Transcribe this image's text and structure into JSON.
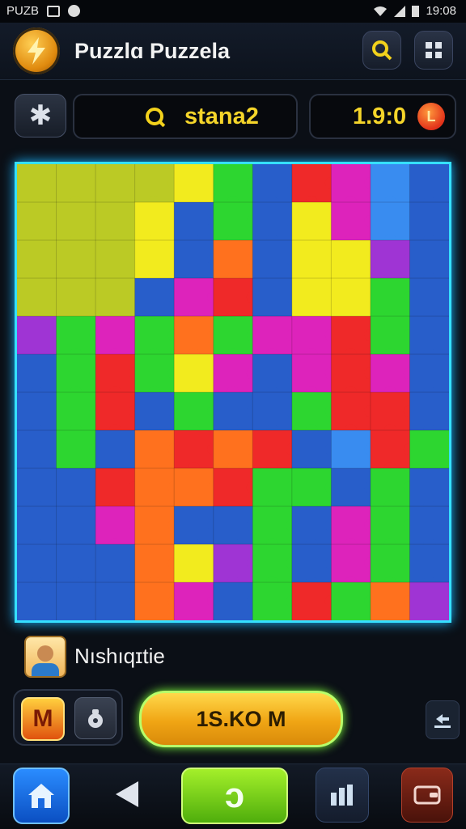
{
  "status_bar": {
    "carrier": "PUZB",
    "time": "19:08"
  },
  "header": {
    "title": "Puzzlɑ Puzzela",
    "logo_icon": "lightning-bolt-icon",
    "search_icon": "search-icon",
    "grid_icon": "grid-icon"
  },
  "toolbar": {
    "settings_icon": "gear-icon",
    "search_text": "stana2",
    "timer": "1.9:0",
    "timer_icon_label": "L"
  },
  "board": {
    "colors": {
      "yellowgreen": "#b8c81a",
      "yellow": "#f2ea12",
      "green": "#22d425",
      "blue": "#1d56c8",
      "red": "#ef1e1e",
      "magenta": "#dc18b8",
      "orange": "#ff6a12",
      "purple": "#9a2ad2",
      "sky": "#2f86f0"
    },
    "grid": [
      [
        "yellowgreen",
        "yellowgreen",
        "yellowgreen",
        "yellowgreen",
        "yellow",
        "green",
        "blue",
        "red",
        "magenta",
        "sky",
        "blue"
      ],
      [
        "yellowgreen",
        "yellowgreen",
        "yellowgreen",
        "yellow",
        "blue",
        "green",
        "blue",
        "yellow",
        "magenta",
        "sky",
        "blue"
      ],
      [
        "yellowgreen",
        "yellowgreen",
        "yellowgreen",
        "yellow",
        "blue",
        "orange",
        "blue",
        "yellow",
        "yellow",
        "purple",
        "blue"
      ],
      [
        "yellowgreen",
        "yellowgreen",
        "yellowgreen",
        "blue",
        "magenta",
        "red",
        "blue",
        "yellow",
        "yellow",
        "green",
        "blue"
      ],
      [
        "purple",
        "green",
        "magenta",
        "green",
        "orange",
        "green",
        "magenta",
        "magenta",
        "red",
        "green",
        "blue"
      ],
      [
        "blue",
        "green",
        "red",
        "green",
        "yellow",
        "magenta",
        "blue",
        "magenta",
        "red",
        "magenta",
        "blue"
      ],
      [
        "blue",
        "green",
        "red",
        "blue",
        "green",
        "blue",
        "blue",
        "green",
        "red",
        "red",
        "blue"
      ],
      [
        "blue",
        "green",
        "blue",
        "orange",
        "red",
        "orange",
        "red",
        "blue",
        "sky",
        "red",
        "green"
      ],
      [
        "blue",
        "blue",
        "red",
        "orange",
        "orange",
        "red",
        "green",
        "green",
        "blue",
        "green",
        "blue"
      ],
      [
        "blue",
        "blue",
        "magenta",
        "orange",
        "blue",
        "blue",
        "green",
        "blue",
        "magenta",
        "green",
        "blue"
      ],
      [
        "blue",
        "blue",
        "blue",
        "orange",
        "yellow",
        "purple",
        "green",
        "blue",
        "magenta",
        "green",
        "blue"
      ],
      [
        "blue",
        "blue",
        "blue",
        "orange",
        "magenta",
        "blue",
        "green",
        "red",
        "green",
        "orange",
        "purple"
      ]
    ]
  },
  "player": {
    "name": "Nıshıqɪtie",
    "avatar_icon": "player-avatar"
  },
  "actions": {
    "m_label": "M",
    "bag_icon": "bag-icon",
    "play_label": "1S.KO M",
    "share_icon": "share-icon"
  },
  "navbar": {
    "home_icon": "home-icon",
    "back_icon": "back-arrow-icon",
    "center_label": "ɔ",
    "stats_icon": "stats-icon",
    "wallet_icon": "wallet-icon"
  }
}
